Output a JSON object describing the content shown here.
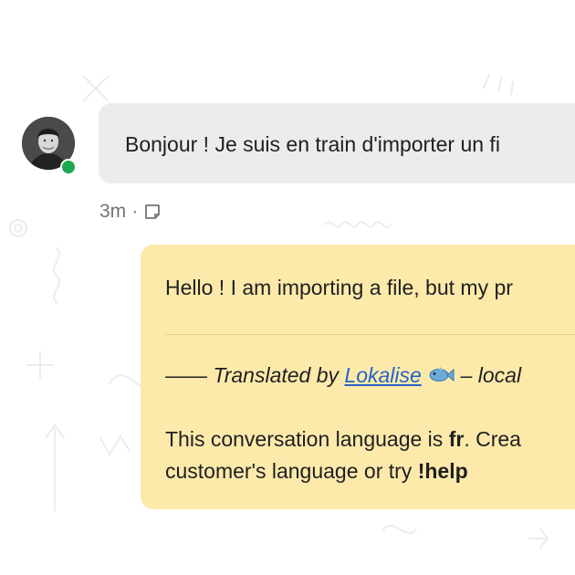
{
  "conversation": {
    "incoming": {
      "text": "Bonjour ! Je suis en train d'importer un fi",
      "time": "3m",
      "separator": "·",
      "note_icon": "note-icon"
    },
    "note": {
      "translation": "Hello ! I am importing a file, but my pr",
      "credit_prefix": "—— Translated by",
      "credit_link": "Lokalise",
      "credit_emoji": "fish-icon",
      "credit_suffix": "– local",
      "language_prefix": "This conversation language is",
      "language_code": "fr",
      "language_suffix": ". Crea",
      "help_prefix": "customer's language or try",
      "help_command": "!help"
    }
  },
  "colors": {
    "incoming_bubble": "#ececec",
    "note_bubble": "#fdeaab",
    "link": "#2563c9",
    "online": "#1fa84f"
  }
}
